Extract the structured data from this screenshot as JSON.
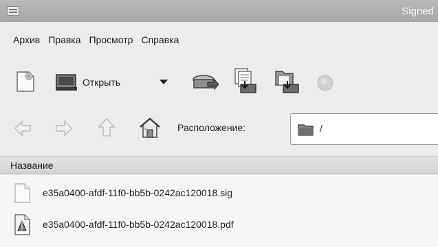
{
  "window": {
    "title": "Signed"
  },
  "menu": [
    "Архив",
    "Правка",
    "Просмотр",
    "Справка"
  ],
  "toolbar": {
    "new_icon": "new-archive-icon",
    "open_label": "Открыть",
    "open_icon": "folder-open-icon",
    "dropdown_icon": "dropdown-arrow-icon",
    "extract_icon": "extract-icon",
    "add_files_icon": "add-files-icon",
    "add_folder_icon": "add-folder-icon",
    "stop_icon": "stop-icon"
  },
  "location": {
    "label": "Расположение:",
    "path": "/"
  },
  "list": {
    "column_name": "Название",
    "files": [
      {
        "name": "e35a0400-afdf-11f0-bb5b-0242ac120018.sig",
        "icon": "file-generic-icon"
      },
      {
        "name": "e35a0400-afdf-11f0-bb5b-0242ac120018.pdf",
        "icon": "file-pdf-icon"
      }
    ]
  }
}
